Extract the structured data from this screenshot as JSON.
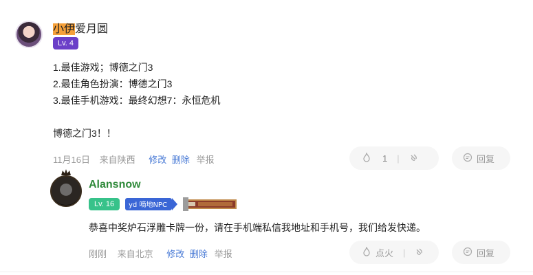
{
  "comment": {
    "username_highlight": "小伊",
    "username_rest": "爱月圆",
    "level": "Lv. 4",
    "lines": [
      "1.最佳游戏；博德之门3",
      "2.最佳角色扮演：博德之门3",
      "3.最佳手机游戏：最终幻想7：永恒危机",
      "博德之门3！！"
    ],
    "date": "11月16日",
    "location": "来自陕西",
    "edit_label": "修改",
    "delete_label": "删除",
    "report_label": "举报",
    "like_count": "1",
    "reply_label": "回复"
  },
  "reply": {
    "username": "Alansnow",
    "level": "Lv. 16",
    "badge_npc_text": "yd 嘀地NPC",
    "text": "恭喜中奖炉石浮雕卡牌一份，请在手机端私信我地址和手机号，我们给发快递。",
    "time": "刚刚",
    "location": "来自北京",
    "edit_label": "修改",
    "delete_label": "删除",
    "report_label": "举报",
    "like_label": "点火",
    "reply_label": "回复"
  },
  "colors": {
    "accent_link": "#4a7bd6",
    "level_purple": "#6b3fc8",
    "level_green": "#37c28a",
    "name_green": "#2f8a3a"
  }
}
